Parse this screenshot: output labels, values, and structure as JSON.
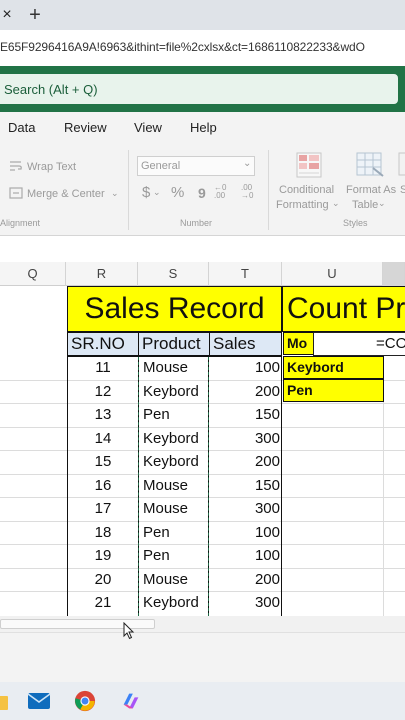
{
  "browser": {
    "close_glyph": "×",
    "new_tab_glyph": "+",
    "url": "E65F9296416A9A!6963&ithint=file%2cxlsx&ct=1686110822233&wdO"
  },
  "excel": {
    "search_text": "Search (Alt + Q)",
    "menu": [
      "Data",
      "Review",
      "View",
      "Help"
    ],
    "ribbon": {
      "wrap_text": "Wrap Text",
      "merge_center": "Merge & Center",
      "alignment_group": "Alignment",
      "number_format": "General",
      "currency": "$",
      "percent": "%",
      "comma": "9",
      "number_group": "Number",
      "conditional_formatting_1": "Conditional",
      "conditional_formatting_2": "Formatting",
      "format_as_table_1": "Format As",
      "format_as_table_2": "Table",
      "styles_group": "Styles",
      "increase_decimal": "←0 .00",
      "decrease_decimal": ".00 →0",
      "cell_styles_partial": "S"
    },
    "columns": [
      "Q",
      "R",
      "S",
      "T",
      "U"
    ],
    "sheet": {
      "sales_title": "Sales Record",
      "count_title": "Count Pr",
      "headers": {
        "srno": "SR.NO",
        "product": "Product",
        "sales": "Sales"
      },
      "rows": [
        {
          "srno": "11",
          "product": "Mouse",
          "sales": "100"
        },
        {
          "srno": "12",
          "product": "Keybord",
          "sales": "200"
        },
        {
          "srno": "13",
          "product": "Pen",
          "sales": "150"
        },
        {
          "srno": "14",
          "product": "Keybord",
          "sales": "300"
        },
        {
          "srno": "15",
          "product": "Keybord",
          "sales": "200"
        },
        {
          "srno": "16",
          "product": "Mouse",
          "sales": "150"
        },
        {
          "srno": "17",
          "product": "Mouse",
          "sales": "300"
        },
        {
          "srno": "18",
          "product": "Pen",
          "sales": "100"
        },
        {
          "srno": "19",
          "product": "Pen",
          "sales": "100"
        },
        {
          "srno": "20",
          "product": "Mouse",
          "sales": "200"
        },
        {
          "srno": "21",
          "product": "Keybord",
          "sales": "300"
        }
      ],
      "count_items": [
        "Mo",
        "Keybord",
        "Pen"
      ],
      "formula_text": "=CO"
    }
  },
  "taskbar": {
    "apps": [
      "file-explorer-icon",
      "mail-icon",
      "chrome-icon",
      "copilot-icon"
    ]
  },
  "colors": {
    "excel_green": "#217346",
    "highlight_yellow": "#ffff00",
    "header_blue": "#dde8f5"
  }
}
